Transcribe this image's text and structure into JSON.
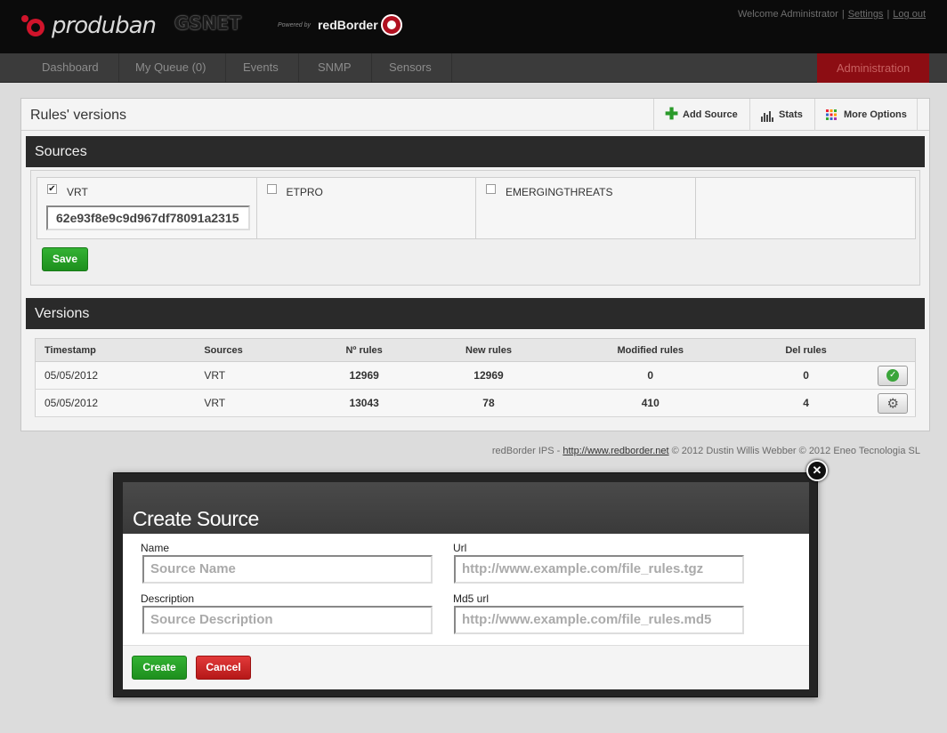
{
  "brand": {
    "name": "produban",
    "partner": "GSNET",
    "powered_prefix": "Powered by",
    "powered_name": "redBorder"
  },
  "user": {
    "welcome": "Welcome Administrator",
    "settings": "Settings",
    "logout": "Log out"
  },
  "nav": {
    "items": [
      "Dashboard",
      "My Queue (0)",
      "Events",
      "SNMP",
      "Sensors"
    ],
    "admin": "Administration"
  },
  "panel": {
    "title": "Rules' versions",
    "add_source": "Add Source",
    "stats": "Stats",
    "more_options": "More Options"
  },
  "sources": {
    "heading": "Sources",
    "items": [
      {
        "name": "VRT",
        "checked": true,
        "oinkcode": "62e93f8e9c9d967df78091a2315"
      },
      {
        "name": "ETPRO",
        "checked": false
      },
      {
        "name": "EMERGINGTHREATS",
        "checked": false
      }
    ],
    "save_label": "Save"
  },
  "versions": {
    "heading": "Versions",
    "columns": [
      "Timestamp",
      "Sources",
      "Nº rules",
      "New rules",
      "Modified rules",
      "Del rules"
    ],
    "rows": [
      {
        "timestamp": "05/05/2012",
        "source": "VRT",
        "rules": "12969",
        "new": "12969",
        "modified": "0",
        "deleted": "0",
        "action": "ok"
      },
      {
        "timestamp": "05/05/2012",
        "source": "VRT",
        "rules": "13043",
        "new": "78",
        "modified": "410",
        "deleted": "4",
        "action": "gear"
      }
    ]
  },
  "footer": {
    "prefix": "redBorder IPS -",
    "link": "http://www.redborder.net",
    "suffix": "© 2012 Dustin Willis Webber © 2012 Eneo Tecnologia SL"
  },
  "modal": {
    "title": "Create Source",
    "name_label": "Name",
    "name_placeholder": "Source Name",
    "url_label": "Url",
    "url_placeholder": "http://www.example.com/file_rules.tgz",
    "description_label": "Description",
    "description_placeholder": "Source Description",
    "md5_label": "Md5 url",
    "md5_placeholder": "http://www.example.com/file_rules.md5",
    "create_label": "Create",
    "cancel_label": "Cancel"
  },
  "colors": {
    "admin_tab": "#8c0d13",
    "save_green": "#1d8f1d",
    "cancel_red": "#b51818",
    "section_bar": "#2a2a2a"
  }
}
